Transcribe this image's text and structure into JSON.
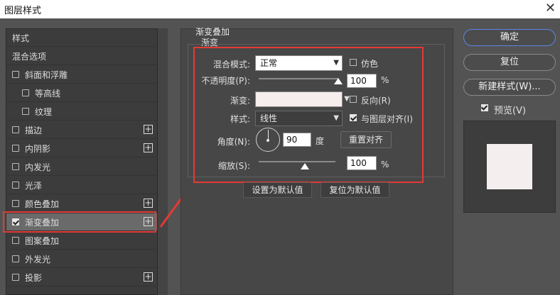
{
  "window": {
    "title": "图层样式",
    "close_glyph": "✕"
  },
  "styles_list": {
    "items": [
      {
        "label": "样式",
        "checkbox": false,
        "checked": false,
        "plus": false,
        "indent": 0
      },
      {
        "label": "混合选项",
        "checkbox": false,
        "checked": false,
        "plus": false,
        "indent": 0
      },
      {
        "label": "斜面和浮雕",
        "checkbox": true,
        "checked": false,
        "plus": false,
        "indent": 0
      },
      {
        "label": "等高线",
        "checkbox": true,
        "checked": false,
        "plus": false,
        "indent": 1
      },
      {
        "label": "纹理",
        "checkbox": true,
        "checked": false,
        "plus": false,
        "indent": 1
      },
      {
        "label": "描边",
        "checkbox": true,
        "checked": false,
        "plus": true,
        "indent": 0
      },
      {
        "label": "内阴影",
        "checkbox": true,
        "checked": false,
        "plus": true,
        "indent": 0
      },
      {
        "label": "内发光",
        "checkbox": true,
        "checked": false,
        "plus": false,
        "indent": 0
      },
      {
        "label": "光泽",
        "checkbox": true,
        "checked": false,
        "plus": false,
        "indent": 0
      },
      {
        "label": "颜色叠加",
        "checkbox": true,
        "checked": false,
        "plus": true,
        "indent": 0
      },
      {
        "label": "渐变叠加",
        "checkbox": true,
        "checked": true,
        "plus": true,
        "indent": 0,
        "selected": true
      },
      {
        "label": "图案叠加",
        "checkbox": true,
        "checked": false,
        "plus": false,
        "indent": 0
      },
      {
        "label": "外发光",
        "checkbox": true,
        "checked": false,
        "plus": false,
        "indent": 0
      },
      {
        "label": "投影",
        "checkbox": true,
        "checked": false,
        "plus": true,
        "indent": 0
      }
    ],
    "plus_glyph": "+"
  },
  "panel": {
    "group_title": "渐变叠加",
    "sub_title": "渐变",
    "blend_mode": {
      "label": "混合模式:",
      "value": "正常"
    },
    "dither": {
      "label": "仿色",
      "checked": false
    },
    "opacity": {
      "label": "不透明度(P):",
      "value": "100",
      "unit": "%",
      "level": 1.0
    },
    "gradient": {
      "label": "渐变:",
      "color": "#f6eded"
    },
    "reverse": {
      "label": "反向(R)",
      "checked": false
    },
    "style": {
      "label": "样式:",
      "value": "线性"
    },
    "align_with_layer": {
      "label": "与图层对齐(I)",
      "checked": true
    },
    "angle": {
      "label": "角度(N):",
      "value": "90",
      "unit": "度"
    },
    "reset_align_button": "重置对齐",
    "scale": {
      "label": "缩放(S):",
      "value": "100",
      "unit": "%",
      "level": 0.6
    },
    "set_default_button": "设置为默认值",
    "reset_default_button": "复位为默认值"
  },
  "right": {
    "ok_button": "确定",
    "reset_button": "复位",
    "new_style_button": "新建样式(W)...",
    "preview": {
      "label": "预览(V)",
      "checked": true
    },
    "preview_swatch_color": "#f4eeee"
  },
  "icons": {
    "dropdown": "chevron-down-icon",
    "checkbox": "checkbox-icon",
    "plus": "plus-icon",
    "angle": "angle-dial-icon"
  },
  "colors": {
    "annotation_red": "#e53935",
    "focus_blue": "#5b86e6"
  }
}
